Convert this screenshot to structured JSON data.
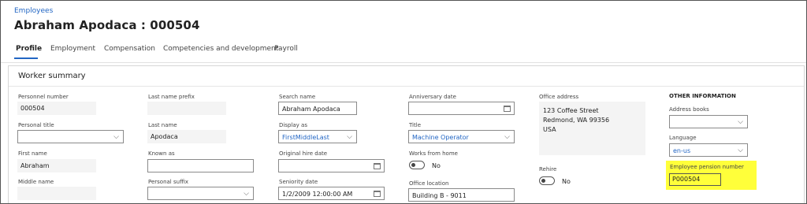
{
  "breadcrumb": "Employees",
  "page_title": "Abraham Apodaca : 000504",
  "tabs": [
    "Profile",
    "Employment",
    "Compensation",
    "Competencies and development",
    "Payroll"
  ],
  "section_title": "Worker summary",
  "col1": {
    "personnel_number_label": "Personnel number",
    "personnel_number": "000504",
    "personal_title_label": "Personal title",
    "personal_title": "",
    "first_name_label": "First name",
    "first_name": "Abraham",
    "middle_name_label": "Middle name",
    "middle_name": ""
  },
  "col2": {
    "last_name_prefix_label": "Last name prefix",
    "last_name_prefix": "",
    "last_name_label": "Last name",
    "last_name": "Apodaca",
    "known_as_label": "Known as",
    "known_as": "",
    "personal_suffix_label": "Personal suffix",
    "personal_suffix": ""
  },
  "col3": {
    "search_name_label": "Search name",
    "search_name": "Abraham Apodaca",
    "display_as_label": "Display as",
    "display_as": "FirstMiddleLast",
    "original_hire_date_label": "Original hire date",
    "original_hire_date": "",
    "seniority_date_label": "Seniority date",
    "seniority_date": "1/2/2009 12:00:00 AM"
  },
  "col4": {
    "anniversary_date_label": "Anniversary date",
    "anniversary_date": "",
    "title_label": "Title",
    "title": "Machine Operator",
    "works_from_home_label": "Works from home",
    "works_from_home": "No",
    "office_location_label": "Office location",
    "office_location": "Building B - 9011"
  },
  "col5": {
    "office_address_label": "Office address",
    "office_address_line1": "123 Coffee Street",
    "office_address_line2": "Redmond, WA 99356",
    "office_address_line3": "USA",
    "rehire_label": "Rehire",
    "rehire": "No"
  },
  "col6": {
    "other_info_heading": "OTHER INFORMATION",
    "address_books_label": "Address books",
    "address_books": "",
    "language_label": "Language",
    "language": "en-us",
    "pension_label": "Employee pension number",
    "pension_number": "P000504"
  },
  "colors": {
    "accent": "#2266c4",
    "highlight": "#ffff3a"
  }
}
